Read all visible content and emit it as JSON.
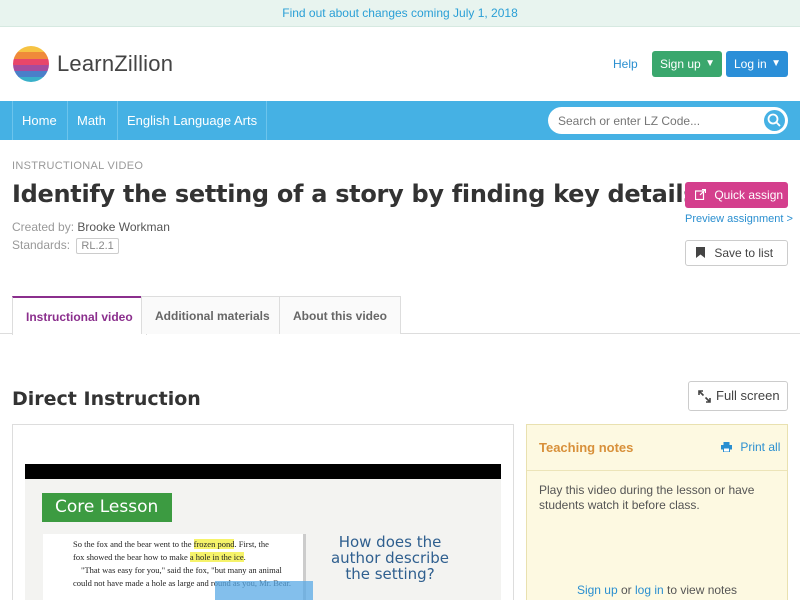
{
  "banner": {
    "text": "Find out about changes coming July 1, 2018"
  },
  "brand": {
    "name": "LearnZillion"
  },
  "header": {
    "help": "Help",
    "signup": "Sign up",
    "login": "Log in"
  },
  "nav": {
    "items": [
      "Home",
      "Math",
      "English Language Arts"
    ],
    "search_placeholder": "Search or enter LZ Code..."
  },
  "lesson": {
    "eyebrow": "INSTRUCTIONAL VIDEO",
    "title": "Identify the setting of a story by finding key details",
    "created_label": "Created by:",
    "author": "Brooke Workman",
    "standards_label": "Standards:",
    "standard": "RL.2.1"
  },
  "actions": {
    "quick_assign": "Quick assign",
    "preview": "Preview assignment >",
    "save": "Save to list"
  },
  "tabs": [
    "Instructional video",
    "Additional materials",
    "About this video"
  ],
  "section": {
    "title": "Direct Instruction",
    "fullscreen": "Full screen"
  },
  "video": {
    "badge": "Core Lesson",
    "line1_a": "So the fox and the bear went to the ",
    "line1_hl": "frozen pond",
    "line1_b": ". First, the",
    "line2_a": "fox showed the bear how to make ",
    "line2_hl": "a hole in the ice",
    "line2_b": ".",
    "line3": "\"That was easy for you,\" said the fox, \"but many an animal",
    "line4": "could not have made a hole as large and round as you, Mr. Bear.",
    "question": "How does the author describe the setting?"
  },
  "notes": {
    "title": "Teaching notes",
    "print": "Print all",
    "body": "Play this video during the lesson or have students watch it before class.",
    "foot_signup": "Sign up",
    "foot_or": " or ",
    "foot_login": "log in",
    "foot_rest": " to view notes"
  },
  "colors": {
    "nav_blue": "#45b1e4",
    "signup_green": "#3aa76d",
    "login_blue": "#2b8fd8",
    "quick_assign_pink": "#d43f8d",
    "tab_active_purple": "#8b2f8d",
    "notes_bg": "#fdf9e1",
    "notes_title": "#d8903a"
  }
}
